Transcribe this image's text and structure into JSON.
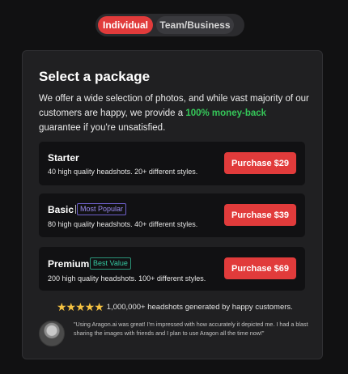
{
  "toggle": {
    "individual": "Individual",
    "team": "Team/Business"
  },
  "card": {
    "title": "Select a package",
    "description_pre": "We offer a wide selection of photos, and while vast majority of our customers are happy, we provide a ",
    "description_highlight": "100% money-back",
    "description_post": " guarantee if you're unsatisfied."
  },
  "packages": [
    {
      "name": "Starter",
      "badge": "",
      "description": "40 high quality headshots. 20+ different styles.",
      "button": "Purchase $29"
    },
    {
      "name": "Basic",
      "badge": "Most Popular",
      "description": "80 high quality headshots. 40+ different styles.",
      "button": "Purchase $39"
    },
    {
      "name": "Premium",
      "badge": "Best Value",
      "description": "200 high quality headshots. 100+ different styles.",
      "button": "Purchase $69"
    }
  ],
  "stats": {
    "stars": "★★★★★",
    "rating": 5,
    "text": "1,000,000+ headshots generated by happy customers."
  },
  "review": {
    "text": "\"Using Aragon.ai was great! I'm impressed with how accurately it depicted me. I had a blast sharing the images with friends and I plan to use Aragon all the time now!\""
  },
  "colors": {
    "accent": "#e13b3b",
    "highlight_green": "#35c759",
    "badge_popular": "#9c8cf3",
    "badge_value": "#35c8a0",
    "star": "#f6c342"
  }
}
